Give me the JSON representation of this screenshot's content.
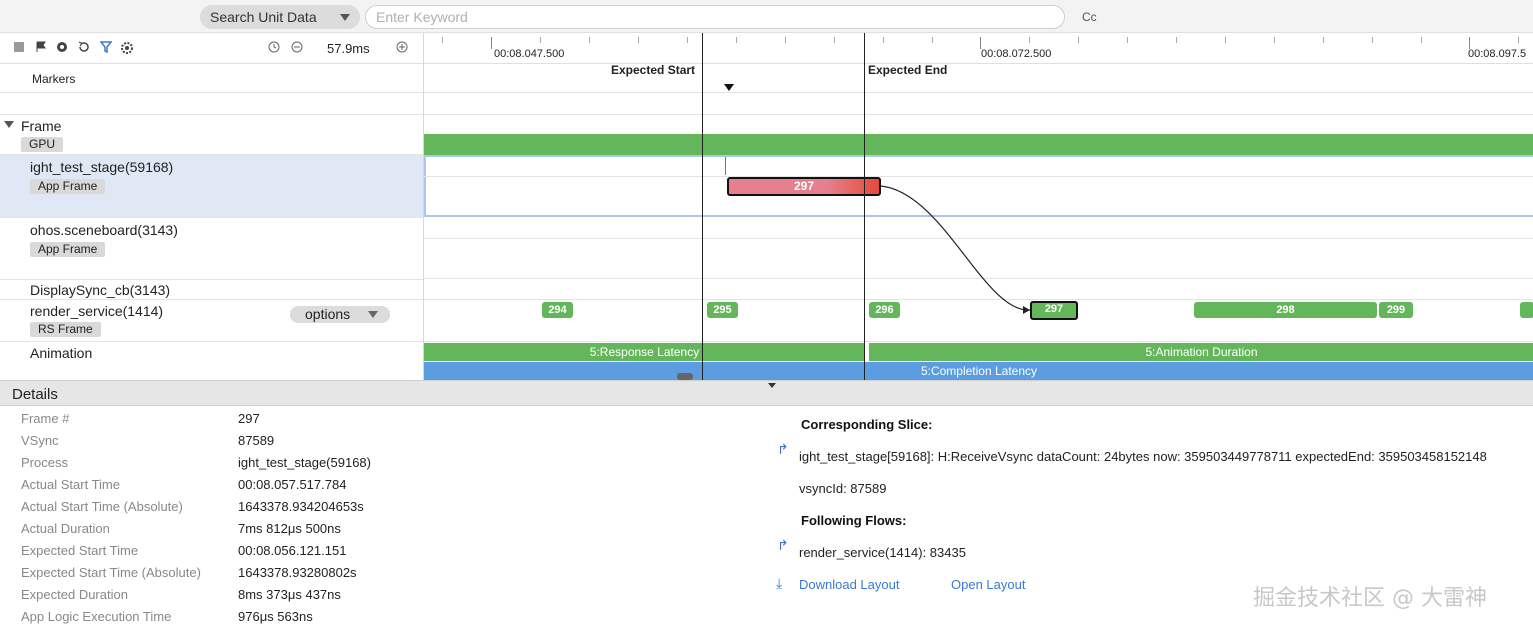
{
  "search": {
    "unit_label": "Search Unit Data",
    "keyword_placeholder": "Enter Keyword",
    "case_label": "Cc"
  },
  "toolbar": {
    "zoom_value": "57.9ms",
    "icons": [
      "square-icon",
      "flag-icon",
      "pin-icon",
      "refresh-icon",
      "filter-icon",
      "settings-icon",
      "clock-icon",
      "zoom-out-icon",
      "zoom-in-icon"
    ]
  },
  "ruler": {
    "labels": [
      "00:08.047.500",
      "00:08.072.500",
      "00:08.097.5"
    ]
  },
  "markers": {
    "row_label": "Markers",
    "expected_start": "Expected Start",
    "expected_end": "Expected End"
  },
  "rows": {
    "frame": "Frame",
    "gpu_tag": "GPU",
    "stage": "ight_test_stage(59168)",
    "stage_tag": "App Frame",
    "sceneboard": "ohos.sceneboard(3143)",
    "sceneboard_tag": "App Frame",
    "displaysync": "DisplaySync_cb(3143)",
    "render": "render_service(1414)",
    "render_tag": "RS Frame",
    "options_label": "options",
    "animation": "Animation"
  },
  "frames": {
    "app_selected": "297",
    "rs": [
      "294",
      "295",
      "296",
      "297",
      "298",
      "299"
    ]
  },
  "animation": {
    "response": "5:Response Latency",
    "duration": "5:Animation Duration",
    "completion": "5:Completion Latency"
  },
  "colors": {
    "green": "#63b75a",
    "red": "#e44a3a",
    "pink": "#e6808e",
    "blue": "#5b9de0",
    "link": "#3a78d6"
  },
  "details": {
    "title": "Details",
    "fields": [
      {
        "key": "Frame #",
        "value": "297"
      },
      {
        "key": "VSync",
        "value": "87589"
      },
      {
        "key": "Process",
        "value": "ight_test_stage(59168)"
      },
      {
        "key": "Actual Start Time",
        "value": "00:08.057.517.784"
      },
      {
        "key": "Actual Start Time (Absolute)",
        "value": "1643378.934204653s"
      },
      {
        "key": "Actual Duration",
        "value": "7ms 812μs 500ns"
      },
      {
        "key": "Expected Start Time",
        "value": "00:08.056.121.151"
      },
      {
        "key": "Expected Start Time (Absolute)",
        "value": "1643378.93280802s"
      },
      {
        "key": "Expected Duration",
        "value": "8ms 373μs 437ns"
      },
      {
        "key": "App Logic Execution Time",
        "value": "976μs 563ns"
      }
    ],
    "corresponding_title": "Corresponding Slice:",
    "corresponding_text": "ight_test_stage[59168]: H:ReceiveVsync dataCount: 24bytes now: 359503449778711 expectedEnd: 359503458152148",
    "vsync_text": "vsyncId: 87589",
    "following_title": "Following Flows:",
    "following_text": "render_service(1414): 83435",
    "download_label": "Download Layout",
    "open_label": "Open Layout"
  },
  "watermark": "掘金技术社区 @ 大雷神"
}
